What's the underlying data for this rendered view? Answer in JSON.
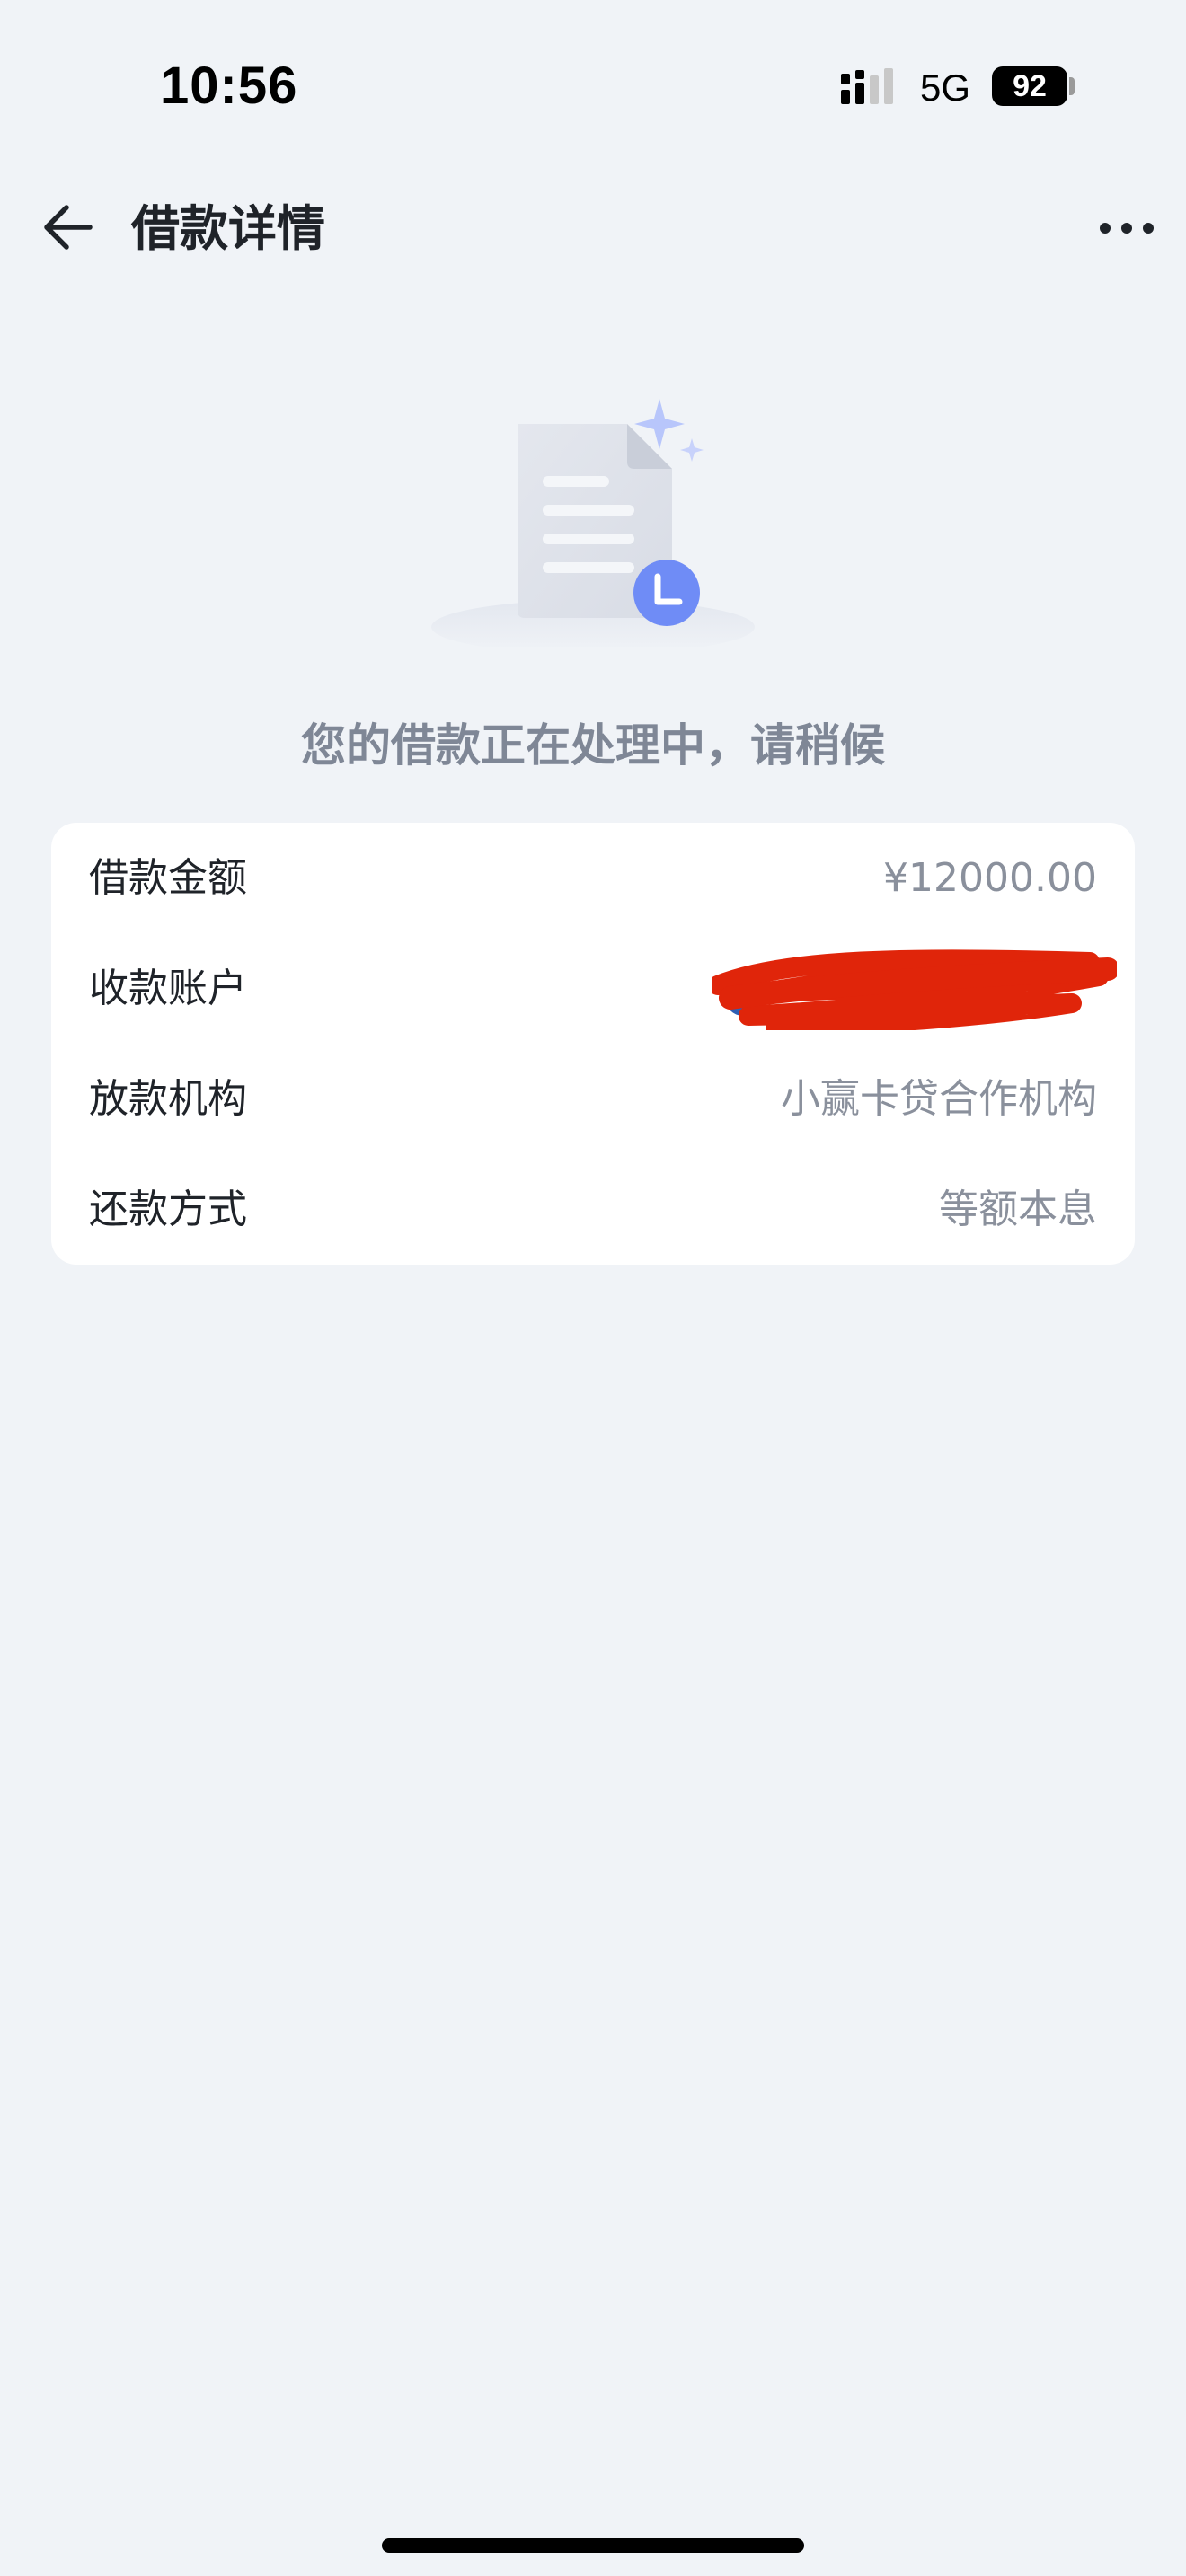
{
  "status_bar": {
    "time": "10:56",
    "network": "5G",
    "battery": "92"
  },
  "nav": {
    "title": "借款详情",
    "back_icon": "arrow-left-icon",
    "more_icon": "more-dots-icon"
  },
  "illustration": {
    "icon": "document-clock-icon",
    "accent_color": "#6f8cf6"
  },
  "status_message": "您的借款正在处理中，请稍候",
  "details": [
    {
      "label": "借款金额",
      "value": "¥12000.00"
    },
    {
      "label": "收款账户",
      "value": "",
      "redacted": true
    },
    {
      "label": "放款机构",
      "value": "小赢卡贷合作机构"
    },
    {
      "label": "还款方式",
      "value": "等额本息"
    }
  ],
  "colors": {
    "background": "#f0f3f7",
    "card": "#ffffff",
    "label_text": "#1f2329",
    "value_text": "#8a909c",
    "redaction": "#e0250a"
  }
}
